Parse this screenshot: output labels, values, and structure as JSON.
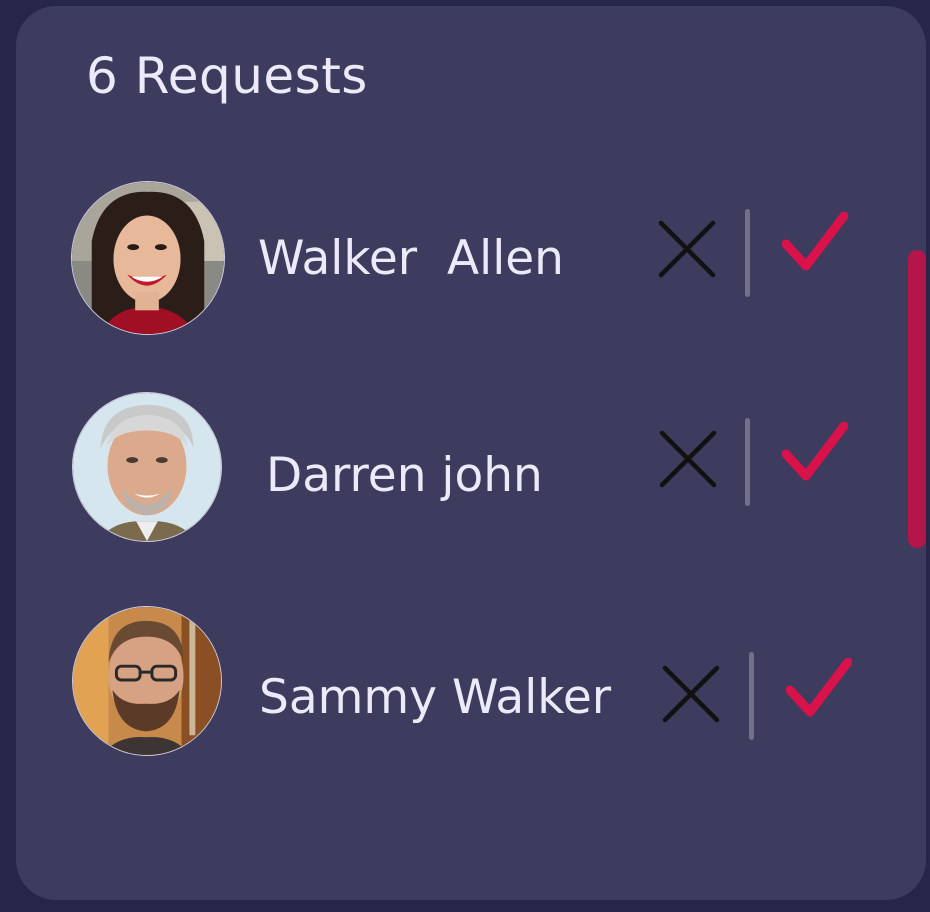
{
  "header": {
    "title": "6 Requests"
  },
  "requests": [
    {
      "name": "Walker  Allen",
      "avatar": "woman-avatar"
    },
    {
      "name": "Darren john",
      "avatar": "gray-haired-man-avatar"
    },
    {
      "name": "Sammy Walker",
      "avatar": "bearded-man-avatar"
    }
  ],
  "icons": {
    "reject": "close-icon",
    "accept": "check-icon"
  },
  "colors": {
    "background": "#25264a",
    "card": "#3d3b5e",
    "text": "#eceaf8",
    "accent": "#d9124a",
    "reject_icon": "#111111",
    "divider": "#737088",
    "scrollbar": "#b4154a"
  }
}
